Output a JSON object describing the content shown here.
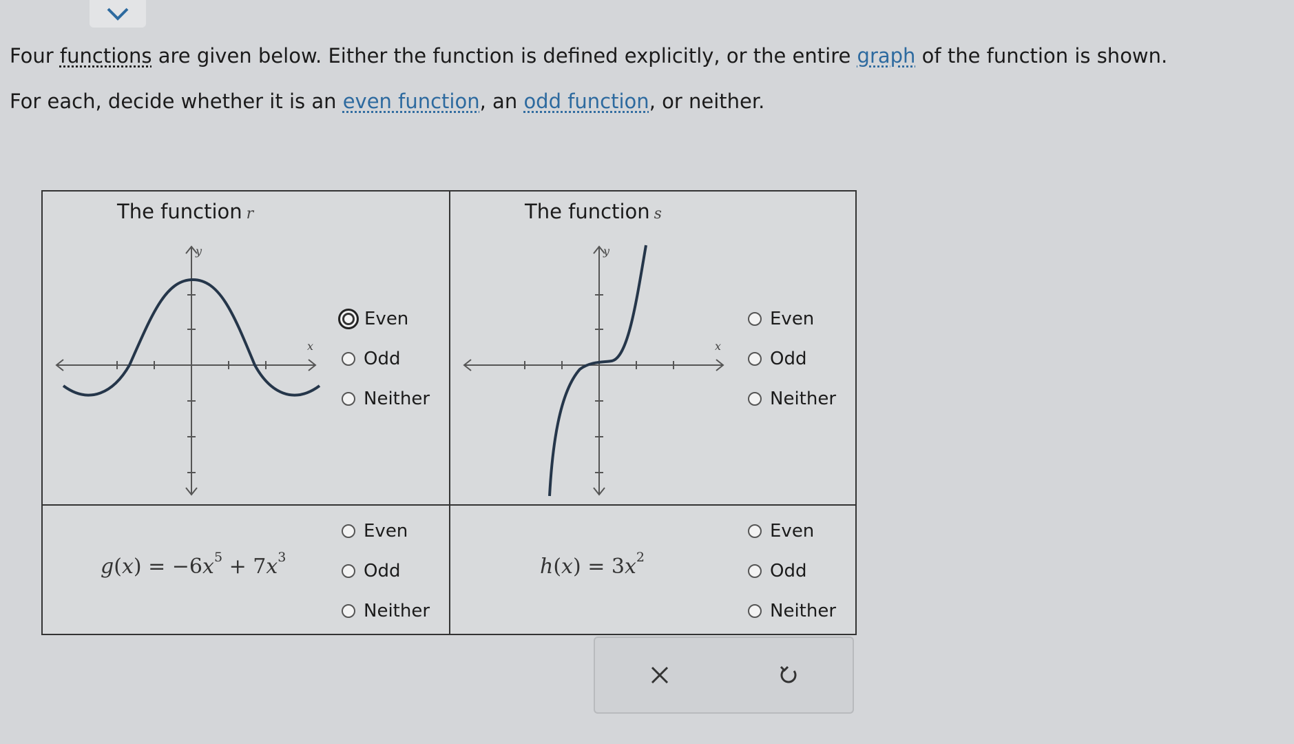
{
  "instructions": {
    "line1_pre": "Four ",
    "line1_link1": "functions",
    "line1_mid": " are given below. Either the function is defined explicitly, or the entire ",
    "line1_link2": "graph",
    "line1_post": " of the function is shown.",
    "line2_pre": "For each, decide whether it is an ",
    "line2_link1": "even function",
    "line2_mid": ", an ",
    "line2_link2": "odd function",
    "line2_post": ", or neither."
  },
  "cells": {
    "r": {
      "title": "The function",
      "var": "r"
    },
    "s": {
      "title": "The function",
      "var": "s"
    },
    "g": {
      "name": "g",
      "arg": "x",
      "c1": "−6",
      "e1": "5",
      "c2": "7",
      "e2": "3"
    },
    "h": {
      "name": "h",
      "arg": "x",
      "c1": "3",
      "e1": "2"
    }
  },
  "options": {
    "even": "Even",
    "odd": "Odd",
    "neither": "Neither"
  },
  "selected": {
    "r": "even",
    "s": null,
    "g": null,
    "h": null
  },
  "graph_labels": {
    "x": "x",
    "y": "y"
  },
  "actions": {
    "clear": "×",
    "undo": "↺"
  },
  "colors": {
    "curve": "#25364a",
    "axis": "#555555",
    "link": "#2d6a9f"
  }
}
